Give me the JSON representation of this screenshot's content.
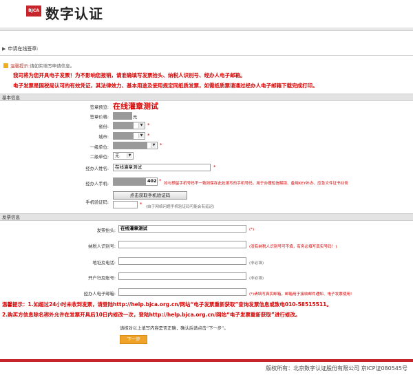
{
  "header": {
    "logo_badge": "BJCA",
    "logo_text": "数字认证"
  },
  "page": {
    "section_title": "申请在线签章:",
    "tip_label": "温馨提示:",
    "tip_text": "请如实填写申请信息。",
    "notice_line1": "我司将为您开具电子发票！为不影响您报销，请准确填写发票抬头、纳税人识别号、经办人电子邮箱。",
    "notice_line2": "电子发票是国税局认可的有效凭证，其法律效力、基本用途及使用规定同纸质发票，如需纸质票请通过经办人电子邮箱下载完成打印。"
  },
  "basic": {
    "panel_title": "基本信息",
    "seal_preview_label": "签章预览:",
    "seal_preview_value": "在线灌章测试",
    "seal_price_label": "签章价格:",
    "seal_price_unit": "元",
    "province_label": "省份:",
    "city_label": "城市:",
    "level1_label": "一级单位:",
    "level2_label": "二级单位:",
    "level2_value": "无",
    "name_label": "经办人姓名:",
    "name_value": "在线灌章测试",
    "phone_label": "经办人手机:",
    "phone_suffix": "402",
    "phone_note": "如与预留手机号码不一致则保存此处填写的手机号码，用于办理短信解锁、备用KEY补办、应急文件证书业务",
    "code_label": "手机验证码:",
    "code_button": "点击获取手机验证码",
    "code_note": "(由于网络问题手机验证码可能会有延迟)"
  },
  "invoice": {
    "panel_title": "发票信息",
    "title_label": "发票抬头:",
    "title_value": "在线灌章测试",
    "title_required": "(*)",
    "taxid_label": "纳税人识别号:",
    "taxid_note": "(没有纳税人识别号可不填，有务必填写真实号码！)",
    "address_label": "地址及电话:",
    "address_note": "(非必填)",
    "bank_label": "开户行及账号:",
    "bank_note": "(非必填)",
    "email_label": "经办人电子邮箱:",
    "email_note": "(*)请填写真实邮箱，邮箱用于接收邮件通知、电子发票使用!"
  },
  "warnings": {
    "line1": "温馨提示：1.如超过24小时未收到发票，请登陆http://help.bjca.org.cn/网站“电子发票重新获取”查询发票信息或致电010-58515511。",
    "line2": "2.购买方信息除名称外允许在发票开具后10日内修改一次，登陆http://help.bjca.org.cn/网站“电子发票重新获取”进行修改。"
  },
  "actions": {
    "confirm_text": "请核对以上填写内容是否正确，确认后请点击“下一步”。",
    "next_button": "下一步"
  },
  "footer": {
    "copyright": "版权所有：北京数字认证股份有限公司  京ICP证080545号"
  },
  "colors": {
    "brand_red": "#c8242b",
    "notice_red": "#d60000",
    "next_orange": "#f0a32a"
  }
}
